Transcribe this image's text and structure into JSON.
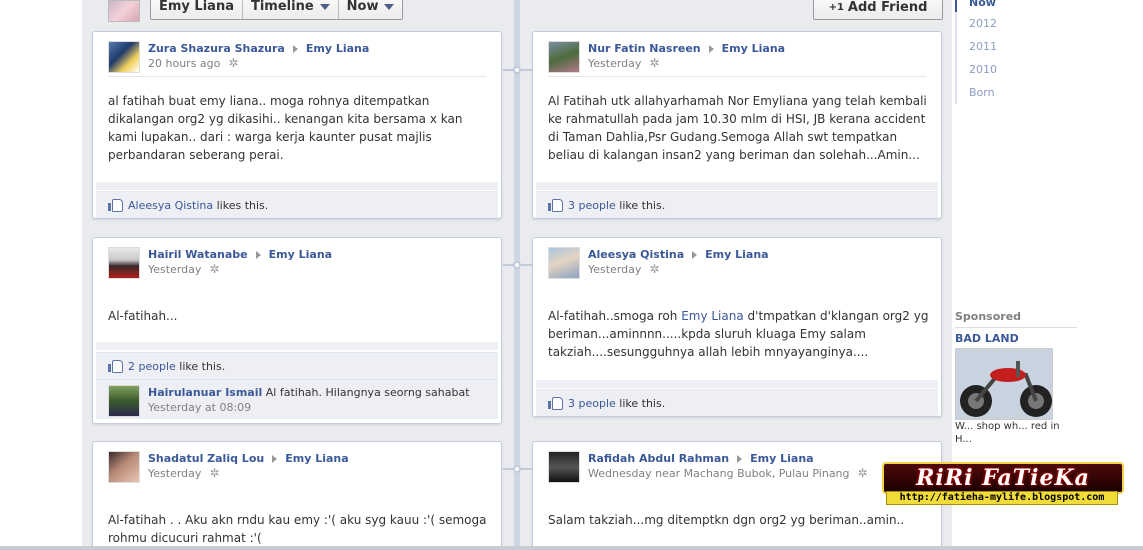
{
  "header": {
    "buttons": [
      "Emy Liana",
      "Timeline",
      "Now"
    ],
    "add_friend": "Add Friend",
    "add_friend_prefix": "+1"
  },
  "posts": [
    {
      "author": "Zura Shazura Shazura",
      "target": "Emy Liana",
      "time": "20 hours ago",
      "text": "al fatihah buat emy liana.. moga rohnya ditempatkan dikalangan org2 yg dikasihi.. kenangan kita bersama x kan kami lupakan.. dari : warga kerja kaunter pusat majlis perbandaran seberang perai.",
      "likes_link": "Aleesya Qistina",
      "likes_rest": "likes this."
    },
    {
      "author": "Nur Fatin Nasreen",
      "target": "Emy Liana",
      "time": "Yesterday",
      "text": "Al Fatihah utk allahyarhamah Nor Emyliana yang telah kembali ke rahmatullah pada jam 10.30 mlm di HSI, JB kerana accident di Taman Dahlia,Psr Gudang.Semoga Allah swt tempatkan beliau di kalangan insan2 yang beriman dan solehah...Amin...",
      "likes_link": "3 people",
      "likes_rest": "like this."
    },
    {
      "author": "Hairil Watanabe",
      "target": "Emy Liana",
      "time": "Yesterday",
      "text": "Al-fatihah...",
      "likes_link": "2 people",
      "likes_rest": "like this.",
      "comment": {
        "author": "Hairulanuar Ismail",
        "text": "Al fatihah. Hilangnya seorng sahabat",
        "time": "Yesterday at 08:09"
      }
    },
    {
      "author": "Aleesya Qistina",
      "target": "Emy Liana",
      "time": "Yesterday",
      "text_before": "Al-fatihah..smoga roh ",
      "text_link": "Emy Liana",
      "text_after": " d'tmpatkan d'klangan org2 yg beriman...aminnnn.....kpda sluruh kluaga Emy salam takziah....sesungguhnya allah lebih mnyayanginya....",
      "likes_link": "3 people",
      "likes_rest": "like this."
    },
    {
      "author": "Shadatul Zaliq Lou",
      "target": "Emy Liana",
      "time": "Yesterday",
      "text": "Al-fatihah . . Aku akn rndu kau emy :'( aku syg kauu :'( semoga rohmu dicucuri rahmat :'("
    },
    {
      "author": "Rafidah Abdul Rahman",
      "target": "Emy Liana",
      "time": "Wednesday near Machang Bubok, Pulau Pinang",
      "text": "Salam takziah...mg ditemptkn dgn org2 yg beriman..amin.."
    }
  ],
  "years": [
    "Now",
    "2012",
    "2011",
    "2010",
    "Born"
  ],
  "sponsored": {
    "title": "Sponsored",
    "ad_title": "BAD LAND",
    "ad_text": "W... shop wh... red in H..."
  },
  "watermark": {
    "name": "RiRi FaTieKa",
    "url": "http://fatieha-mylife.blogspot.com"
  },
  "icons": {
    "settings": "gear-icon",
    "like": "thumbs-up-icon",
    "dropdown": "caret-down-icon"
  },
  "colors": {
    "link": "#3b5998",
    "timeline_bg": "#e9ebee",
    "like_bar": "#edeff4"
  }
}
